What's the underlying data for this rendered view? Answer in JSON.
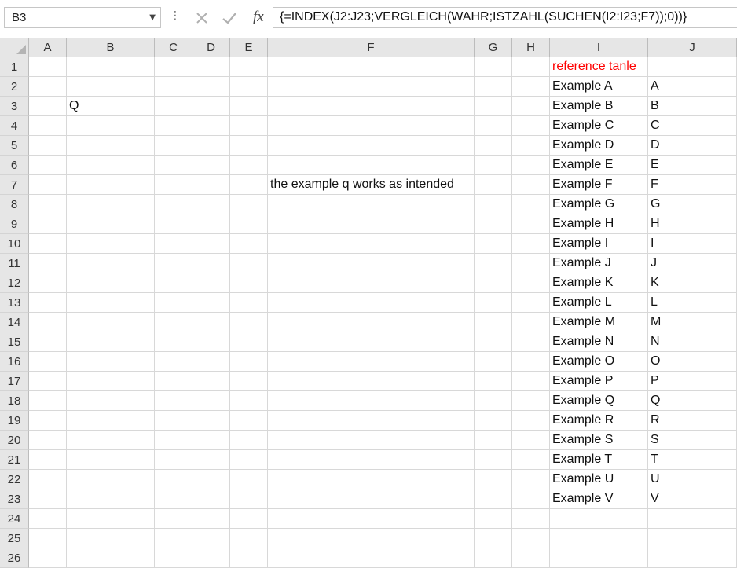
{
  "formula_bar": {
    "name_box": "B3",
    "fx_label": "fx",
    "formula": "{=INDEX(J2:J23;VERGLEICH(WAHR;ISTZAHL(SUCHEN(I2:I23;F7));0))}"
  },
  "columns": [
    "A",
    "B",
    "C",
    "D",
    "E",
    "F",
    "G",
    "H",
    "I",
    "J"
  ],
  "rows": [
    "1",
    "2",
    "3",
    "4",
    "5",
    "6",
    "7",
    "8",
    "9",
    "10",
    "11",
    "12",
    "13",
    "14",
    "15",
    "16",
    "17",
    "18",
    "19",
    "20",
    "21",
    "22",
    "23",
    "24",
    "25",
    "26"
  ],
  "cells": {
    "B3": "Q",
    "F7": "the example q works as intended",
    "I1": "reference tanle",
    "I2": "Example A",
    "J2": "A",
    "I3": "Example B",
    "J3": "B",
    "I4": "Example C",
    "J4": "C",
    "I5": "Example D",
    "J5": "D",
    "I6": "Example E",
    "J6": "E",
    "I7": "Example F",
    "J7": "F",
    "I8": "Example G",
    "J8": "G",
    "I9": "Example H",
    "J9": "H",
    "I10": "Example I",
    "J10": "I",
    "I11": "Example J",
    "J11": "J",
    "I12": "Example K",
    "J12": "K",
    "I13": "Example L",
    "J13": "L",
    "I14": "Example M",
    "J14": "M",
    "I15": "Example N",
    "J15": "N",
    "I16": "Example O",
    "J16": "O",
    "I17": "Example P",
    "J17": "P",
    "I18": "Example Q",
    "J18": "Q",
    "I19": "Example R",
    "J19": "R",
    "I20": "Example S",
    "J20": "S",
    "I21": "Example T",
    "J21": "T",
    "I22": "Example U",
    "J22": "U",
    "I23": "Example V",
    "J23": "V"
  },
  "colors": {
    "red_text": "#ff0000",
    "header_bg": "#e6e6e6",
    "gridline": "#d8d8d8"
  }
}
